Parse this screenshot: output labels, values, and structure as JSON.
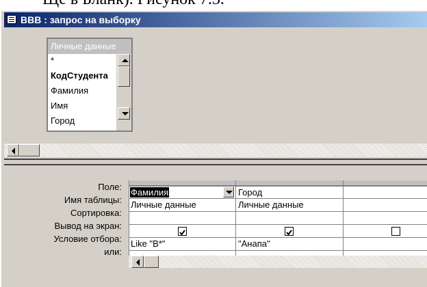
{
  "page_text": "Ще в Бланк). Рисунок 7.3.",
  "window": {
    "title": "ВВВ : запрос на выборку"
  },
  "table_box": {
    "title": "Личные данные",
    "fields": [
      "*",
      "КодСтудента",
      "Фамилия",
      "Имя",
      "Город"
    ]
  },
  "grid": {
    "row_labels": [
      "Поле:",
      "Имя таблицы:",
      "Сортировка:",
      "Вывод на экран:",
      "Условие отбора:",
      "или:"
    ],
    "columns": [
      {
        "field": "Фамилия",
        "table": "Личные данные",
        "sort": "",
        "show": true,
        "criteria": "Like \"В*\"",
        "or": ""
      },
      {
        "field": "Город",
        "table": "Личные данные",
        "sort": "",
        "show": true,
        "criteria": "\"Анапа\"",
        "or": ""
      },
      {
        "field": "",
        "table": "",
        "sort": "",
        "show": false,
        "criteria": "",
        "or": ""
      }
    ]
  },
  "colors": {
    "title_start": "#0a246a",
    "title_end": "#a6caf0",
    "face": "#d4d0c8"
  }
}
